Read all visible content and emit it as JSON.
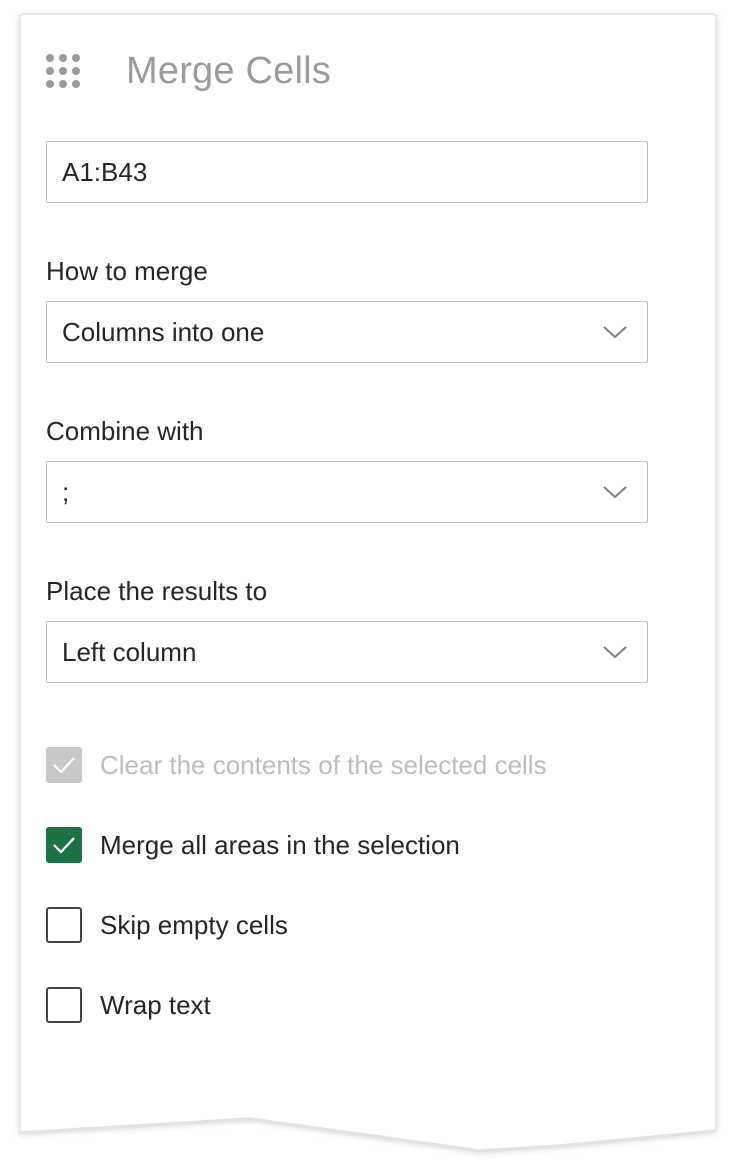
{
  "panel": {
    "title": "Merge Cells"
  },
  "range": {
    "value": "A1:B43"
  },
  "how_to_merge": {
    "label": "How to merge",
    "selected": "Columns into one"
  },
  "combine_with": {
    "label": "Combine with",
    "selected": ";"
  },
  "place_results": {
    "label": "Place the results to",
    "selected": "Left column"
  },
  "options": [
    {
      "label": "Clear the contents of the selected cells",
      "checked": true,
      "disabled": true
    },
    {
      "label": "Merge all areas in the selection",
      "checked": true,
      "disabled": false
    },
    {
      "label": "Skip empty cells",
      "checked": false,
      "disabled": false
    },
    {
      "label": "Wrap text",
      "checked": false,
      "disabled": false
    }
  ],
  "colors": {
    "accent": "#1e7145",
    "disabled": "#c8c8c8",
    "title": "#9b9b9b"
  },
  "icons": {
    "grip": "grip-dots-icon",
    "dropdown": "chevron-down-icon",
    "check": "checkmark-icon"
  }
}
